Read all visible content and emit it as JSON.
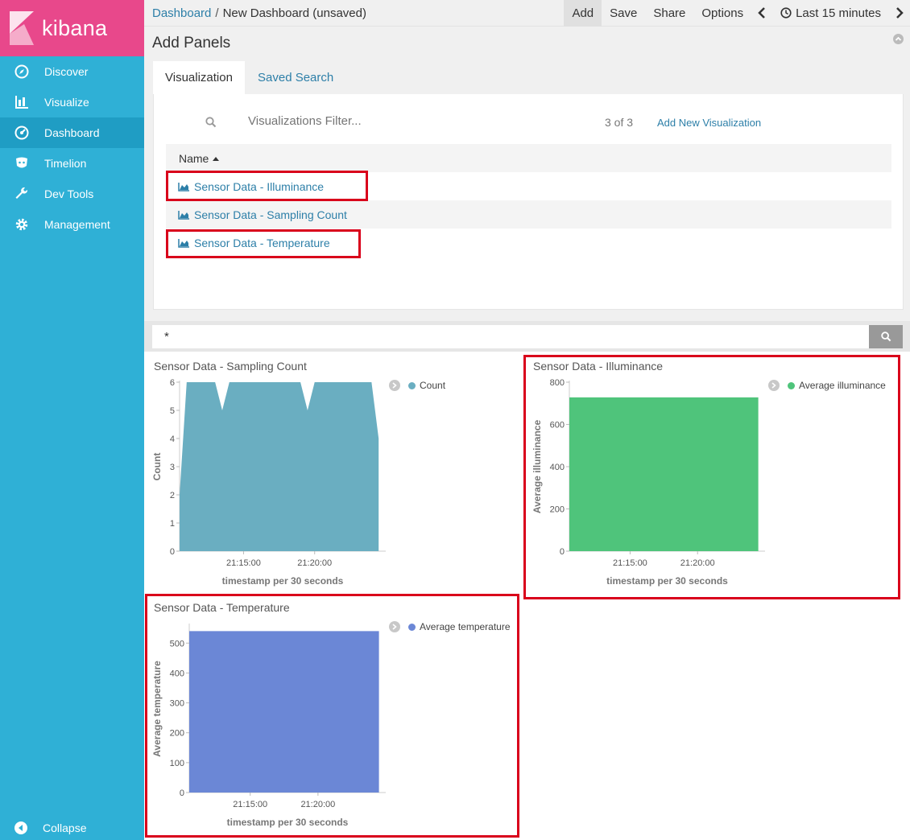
{
  "sidebar": {
    "logo_text": "kibana",
    "items": [
      {
        "label": "Discover",
        "icon": "compass-icon"
      },
      {
        "label": "Visualize",
        "icon": "bar-chart-icon"
      },
      {
        "label": "Dashboard",
        "icon": "dashboard-icon",
        "active": true
      },
      {
        "label": "Timelion",
        "icon": "timelion-icon"
      },
      {
        "label": "Dev Tools",
        "icon": "wrench-icon"
      },
      {
        "label": "Management",
        "icon": "gear-icon"
      }
    ],
    "collapse_label": "Collapse"
  },
  "topbar": {
    "breadcrumb_root": "Dashboard",
    "breadcrumb_sep": "/",
    "breadcrumb_current": "New Dashboard (unsaved)",
    "actions": {
      "add": "Add",
      "save": "Save",
      "share": "Share",
      "options": "Options"
    },
    "time_range": "Last 15 minutes"
  },
  "add_panels": {
    "title": "Add Panels",
    "tabs": {
      "visualization": "Visualization",
      "saved_search": "Saved Search"
    },
    "filter_placeholder": "Visualizations Filter...",
    "count": "3 of 3",
    "add_new": "Add New Visualization",
    "column_name": "Name",
    "rows": [
      {
        "label": "Sensor Data - Illuminance",
        "highlighted": true
      },
      {
        "label": "Sensor Data - Sampling Count",
        "highlighted": false
      },
      {
        "label": "Sensor Data - Temperature",
        "highlighted": true
      }
    ]
  },
  "query": {
    "value": "*"
  },
  "colors": {
    "sidebar": "#2fb0d6",
    "logo_bg": "#e8488b",
    "link": "#2d7fa8",
    "highlight": "#d9001b",
    "count_series": "#6aaec1",
    "illuminance_series": "#4fc47b",
    "temperature_series": "#6b87d6"
  },
  "panels": {
    "sampling": {
      "title": "Sensor Data - Sampling Count",
      "legend": "Count"
    },
    "illuminance": {
      "title": "Sensor Data - Illuminance",
      "legend": "Average illuminance"
    },
    "temperature": {
      "title": "Sensor Data - Temperature",
      "legend": "Average temperature"
    }
  },
  "chart_data": [
    {
      "type": "area",
      "title": "Sensor Data - Sampling Count",
      "xlabel": "timestamp per 30 seconds",
      "ylabel": "Count",
      "x_ticks": [
        "21:15:00",
        "21:20:00"
      ],
      "y_ticks": [
        0,
        1,
        2,
        3,
        4,
        5,
        6
      ],
      "ylim": [
        0,
        6
      ],
      "xlim": [
        "21:10:30",
        "21:25:00"
      ],
      "series": [
        {
          "name": "Count",
          "x": [
            "21:10:30",
            "21:11:00",
            "21:13:00",
            "21:13:30",
            "21:14:00",
            "21:19:00",
            "21:19:30",
            "21:20:00",
            "21:24:00",
            "21:24:30"
          ],
          "values": [
            2,
            6,
            6,
            5,
            6,
            6,
            5,
            6,
            6,
            4
          ]
        }
      ]
    },
    {
      "type": "area",
      "title": "Sensor Data - Illuminance",
      "xlabel": "timestamp per 30 seconds",
      "ylabel": "Average illuminance",
      "x_ticks": [
        "21:15:00",
        "21:20:00"
      ],
      "y_ticks": [
        0,
        200,
        400,
        600,
        800
      ],
      "ylim": [
        0,
        800
      ],
      "xlim": [
        "21:10:30",
        "21:25:00"
      ],
      "series": [
        {
          "name": "Average illuminance",
          "x": [
            "21:10:30",
            "21:24:30"
          ],
          "values": [
            728,
            728
          ]
        }
      ]
    },
    {
      "type": "area",
      "title": "Sensor Data - Temperature",
      "xlabel": "timestamp per 30 seconds",
      "ylabel": "Average temperature",
      "x_ticks": [
        "21:15:00",
        "21:20:00"
      ],
      "y_ticks": [
        0,
        100,
        200,
        300,
        400,
        500
      ],
      "ylim": [
        0,
        560
      ],
      "xlim": [
        "21:10:30",
        "21:25:00"
      ],
      "series": [
        {
          "name": "Average temperature",
          "x": [
            "21:10:30",
            "21:24:30"
          ],
          "values": [
            540,
            540
          ]
        }
      ]
    }
  ]
}
